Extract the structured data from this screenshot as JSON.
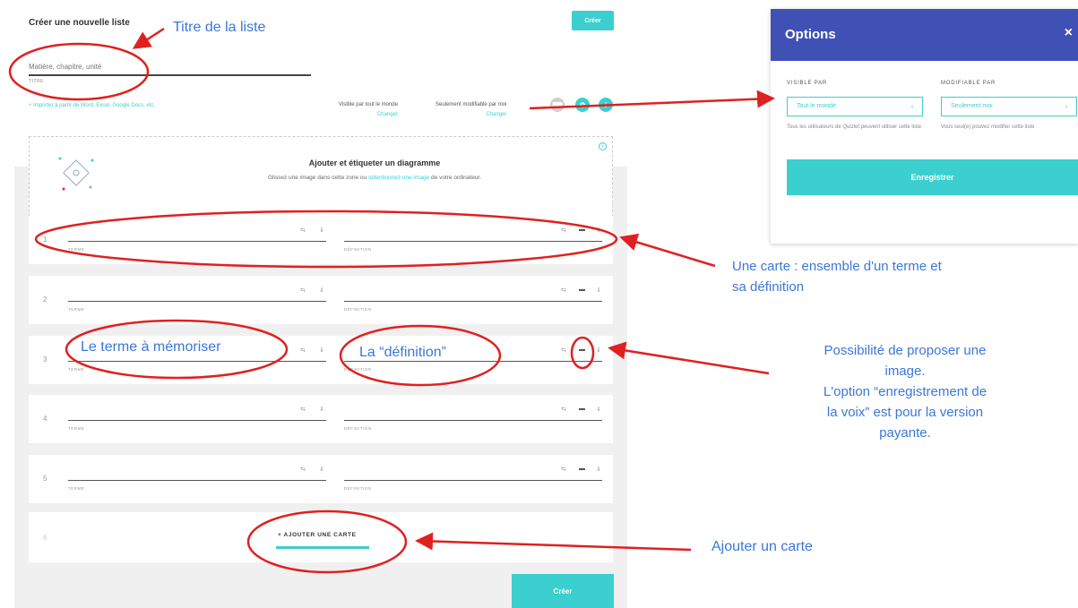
{
  "header": {
    "page_title": "Créer une nouvelle liste",
    "create_label": "Créer"
  },
  "title_field": {
    "placeholder": "Matière, chapitre, unité",
    "label": "TITRE"
  },
  "import_link": "+ Importer à partir de Word, Excel, Google Docs, etc.",
  "visibility": {
    "visible_text": "Visible par tout le monde",
    "visible_change": "Changer",
    "edit_text": "Seulement modifiable par moi",
    "edit_change": "Changer"
  },
  "diagram": {
    "title": "Ajouter et étiqueter un diagramme",
    "sub_before": "Glissez une image dans cette zone ou ",
    "sub_link": "sélectionnez une image",
    "sub_after": " de votre ordinateur."
  },
  "cards": [
    {
      "num": "1",
      "term_label": "TERME",
      "def_label": "DÉFINITION"
    },
    {
      "num": "2",
      "term_label": "TERME",
      "def_label": "DÉFINITION"
    },
    {
      "num": "3",
      "term_label": "TERME",
      "def_label": "DÉFINITION"
    },
    {
      "num": "4",
      "term_label": "TERME",
      "def_label": "DÉFINITION"
    },
    {
      "num": "5",
      "term_label": "TERME",
      "def_label": "DÉFINITION"
    }
  ],
  "add_card": {
    "num": "6",
    "label": "+ AJOUTER UNE CARTE"
  },
  "bottom_create": "Créer",
  "options": {
    "title": "Options",
    "close": "×",
    "visible_label": "VISIBLE PAR",
    "visible_value": "Tout le monde",
    "visible_desc": "Tous les utilisateurs de Quizlet peuvent utiliser cette liste",
    "edit_label": "MODIFIABLE PAR",
    "edit_value": "Seulement moi",
    "edit_desc": "Vous seul(e) pouvez modifier cette liste",
    "save": "Enregistrer"
  },
  "annotations": {
    "title": "Titre de la liste",
    "card_1": "Une carte : ensemble d'un terme et",
    "card_2": "sa définition",
    "term": "Le terme à mémoriser",
    "definition": "La “définition”",
    "image_1": "Possibilité de proposer une",
    "image_2": "image.",
    "image_3": "L'option “enregistrement de",
    "image_4": "la voix” est pour la version",
    "image_5": "payante.",
    "add": "Ajouter un carte"
  },
  "colors": {
    "accent": "#3ccfcf",
    "header_blue": "#3f51b5",
    "annotation_red": "#e02020",
    "annotation_text": "#3b77d8"
  }
}
